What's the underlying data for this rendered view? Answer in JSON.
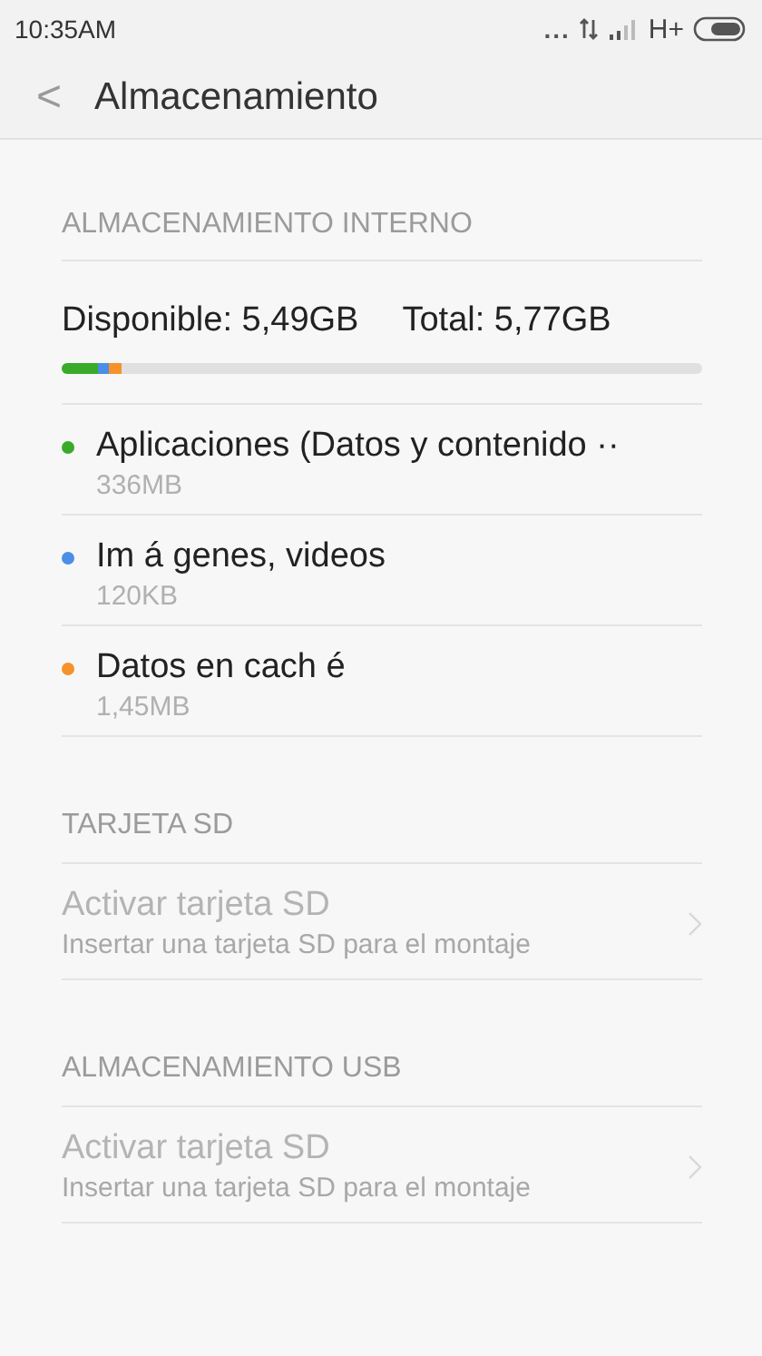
{
  "status_bar": {
    "time": "10:35AM",
    "dots": "...",
    "network": "H+"
  },
  "header": {
    "back": "<",
    "title": "Almacenamiento"
  },
  "internal": {
    "heading": "ALMACENAMIENTO INTERNO",
    "available": "Disponible: 5,49GB",
    "total": "Total: 5,77GB",
    "categories": [
      {
        "name": "Aplicaciones (Datos y contenido ··",
        "size": "336MB",
        "color": "#3aaa2a"
      },
      {
        "name": "Im á genes, videos",
        "size": "120KB",
        "color": "#4a8ee8"
      },
      {
        "name": "Datos en cach é",
        "size": "1,45MB",
        "color": "#f5922a"
      }
    ]
  },
  "sections": [
    {
      "heading": "TARJETA SD",
      "items": [
        {
          "title": "Activar tarjeta SD",
          "subtitle": "Insertar una tarjeta SD para el montaje",
          "disabled": true
        }
      ]
    },
    {
      "heading": "ALMACENAMIENTO USB",
      "items": [
        {
          "title": "Activar tarjeta SD",
          "subtitle": "Insertar una tarjeta SD para el montaje",
          "disabled": true
        }
      ]
    }
  ]
}
